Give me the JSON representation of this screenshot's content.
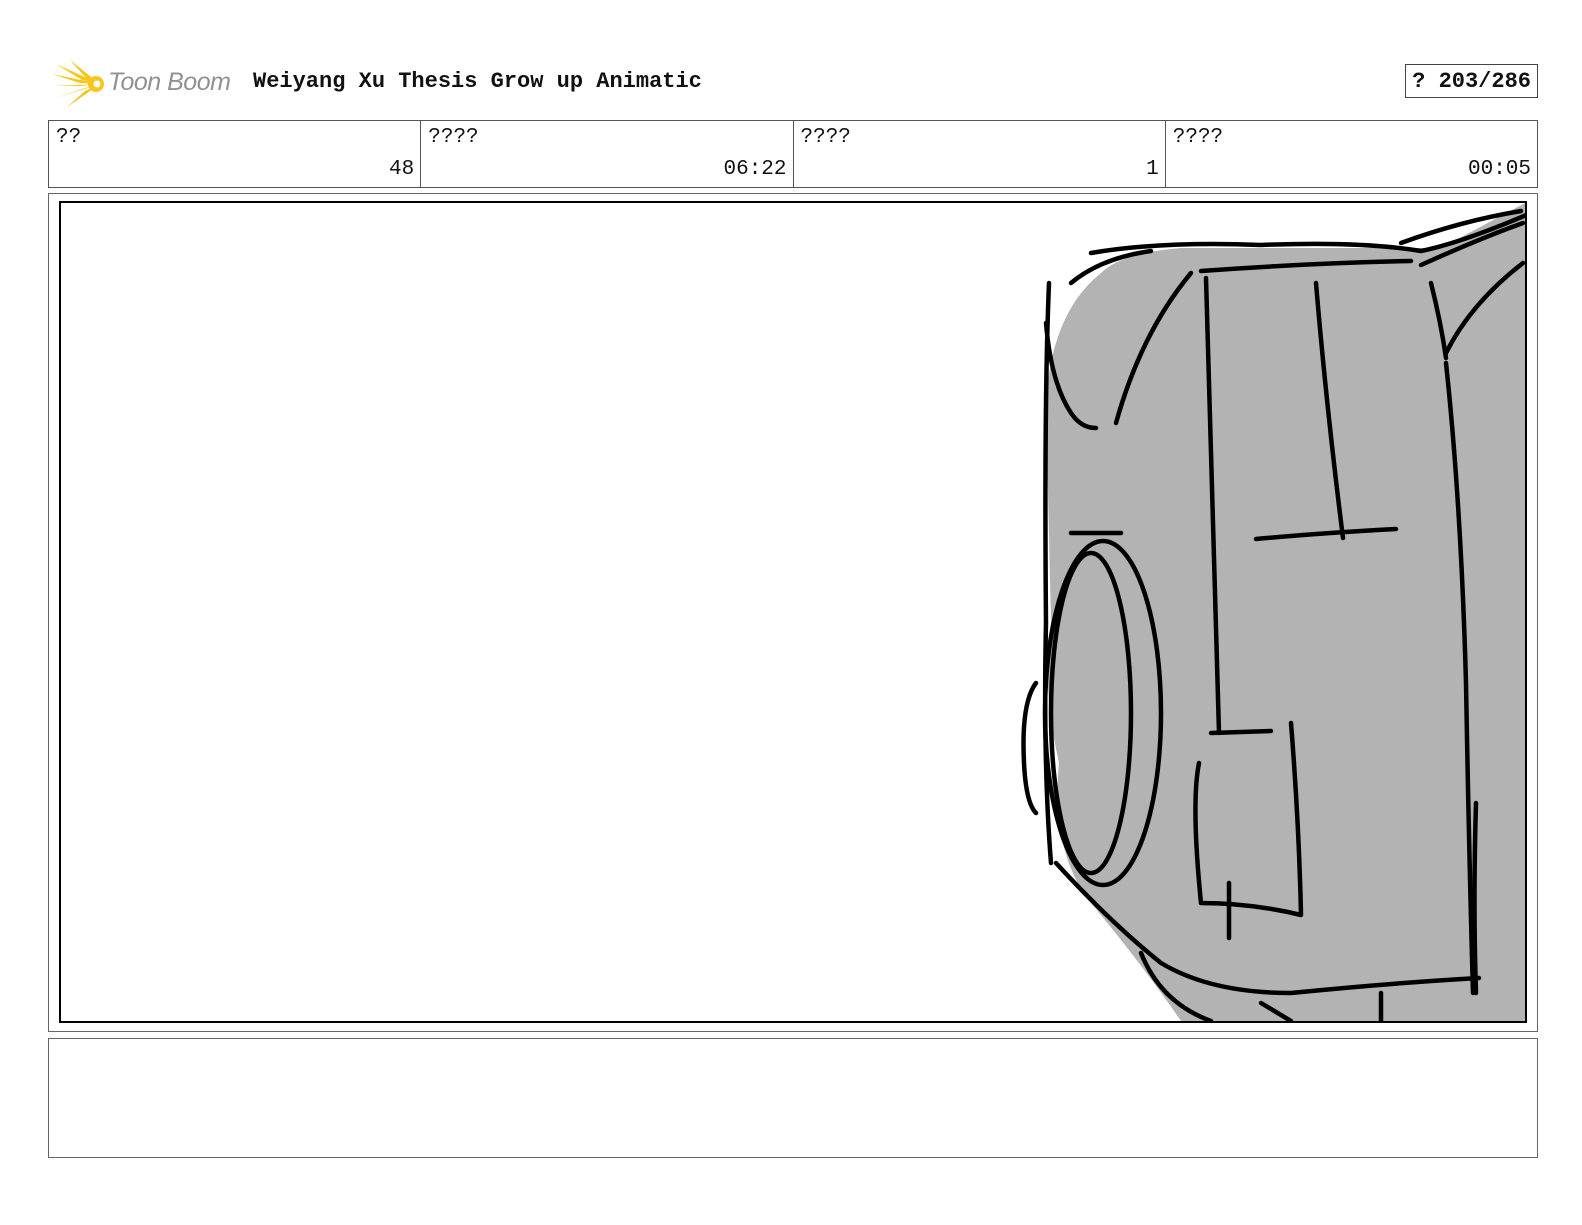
{
  "header": {
    "logo_text": "Toon Boom",
    "title": "Weiyang Xu Thesis Grow up Animatic",
    "page_indicator": "? 203/286"
  },
  "info": [
    {
      "label": "??",
      "value": "48"
    },
    {
      "label": "????",
      "value": "06:22"
    },
    {
      "label": "????",
      "value": "1"
    },
    {
      "label": "????",
      "value": "00:05"
    }
  ],
  "panel": {
    "drawing": "sketch-car-rear",
    "fill_color": "#b3b3b3",
    "stroke_color": "#000000"
  },
  "notes": {
    "text": ""
  },
  "colors": {
    "logo_star": "#f5c61c",
    "logo_text": "#8f9293"
  }
}
